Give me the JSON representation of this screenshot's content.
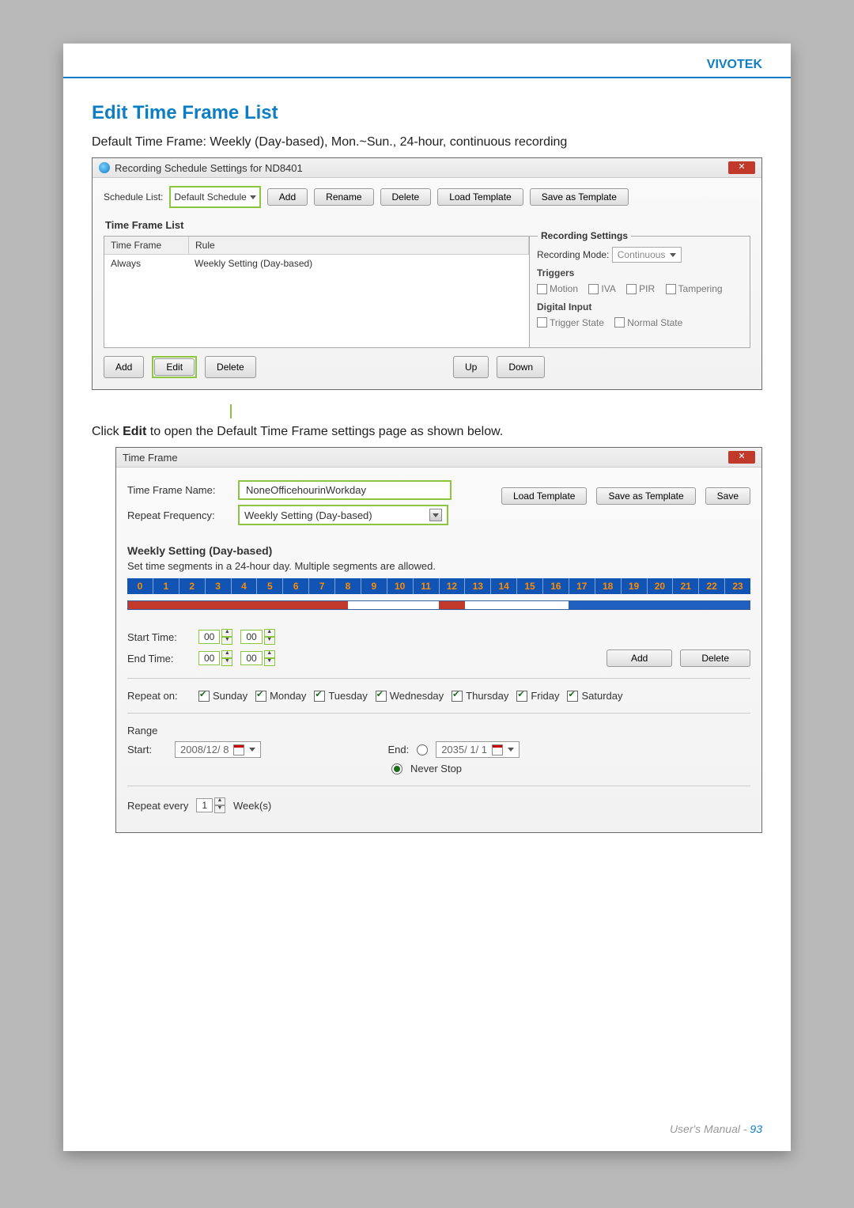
{
  "brand": "VIVOTEK",
  "heading": "Edit Time Frame List",
  "intro": "Default Time Frame: Weekly (Day-based), Mon.~Sun., 24-hour, continuous recording",
  "dialog1": {
    "title": "Recording Schedule Settings for ND8401",
    "schedule_list_label": "Schedule List:",
    "schedule_value": "Default Schedule",
    "buttons": {
      "add": "Add",
      "rename": "Rename",
      "delete": "Delete",
      "load": "Load Template",
      "saveas": "Save as Template"
    },
    "tfl_label": "Time Frame List",
    "col_tf": "Time Frame",
    "col_rule": "Rule",
    "row_tf": "Always",
    "row_rule": "Weekly Setting (Day-based)",
    "rec_title": "Recording Settings",
    "rec_mode_label": "Recording Mode:",
    "rec_mode_value": "Continuous",
    "triggers_label": "Triggers",
    "t_motion": "Motion",
    "t_iva": "IVA",
    "t_pir": "PIR",
    "t_tamper": "Tampering",
    "di_label": "Digital Input",
    "di_trigger": "Trigger State",
    "di_normal": "Normal State",
    "bottom": {
      "add": "Add",
      "edit": "Edit",
      "delete": "Delete",
      "up": "Up",
      "down": "Down"
    }
  },
  "mid_text_pre": "Click ",
  "mid_text_bold": "Edit",
  "mid_text_post": " to open the Default Time Frame settings page as shown below.",
  "dialog2": {
    "title": "Time Frame",
    "name_label": "Time Frame Name:",
    "name_value": "NoneOfficehourinWorkday",
    "repeat_label": "Repeat Frequency:",
    "repeat_value": "Weekly Setting (Day-based)",
    "buttons": {
      "load": "Load Template",
      "saveas": "Save as Template",
      "save": "Save"
    },
    "section": "Weekly Setting (Day-based)",
    "note": "Set time segments in a 24-hour day. Multiple segments are allowed.",
    "hours": [
      "0",
      "1",
      "2",
      "3",
      "4",
      "5",
      "6",
      "7",
      "8",
      "9",
      "10",
      "11",
      "12",
      "13",
      "14",
      "15",
      "16",
      "17",
      "18",
      "19",
      "20",
      "21",
      "22",
      "23"
    ],
    "start_label": "Start Time:",
    "end_label": "End Time:",
    "spin_h": "00",
    "spin_m": "00",
    "add_btn": "Add",
    "del_btn": "Delete",
    "repeat_on": "Repeat on:",
    "days": [
      "Sunday",
      "Monday",
      "Tuesday",
      "Wednesday",
      "Thursday",
      "Friday",
      "Saturday"
    ],
    "range": "Range",
    "start_d_label": "Start:",
    "start_d": "2008/12/ 8",
    "end_d_label": "End:",
    "end_d": "2035/ 1/ 1",
    "never": "Never Stop",
    "every_pre": "Repeat every",
    "every_val": "1",
    "every_unit": "Week(s)"
  },
  "footer_text": "User's Manual - ",
  "footer_page": "93"
}
